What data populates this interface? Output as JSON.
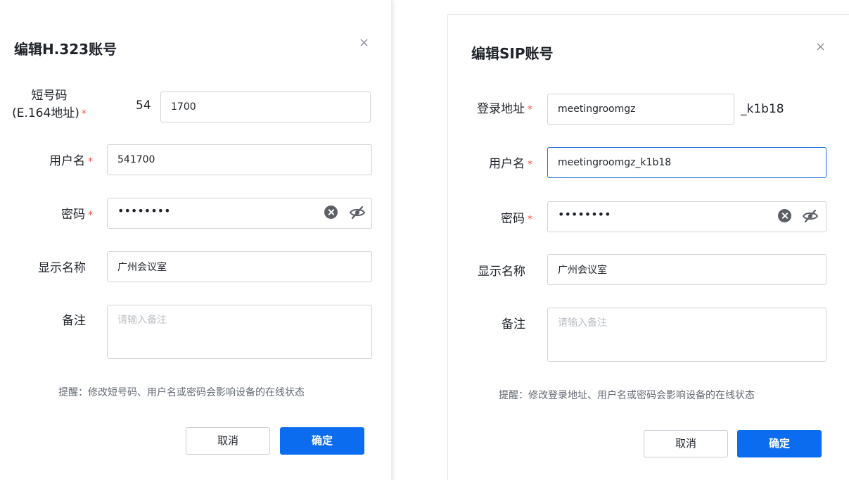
{
  "h323": {
    "title": "编辑H.323账号",
    "close": "×",
    "e164_label_line1": "短号码",
    "e164_label_line2": "(E.164地址)",
    "required_mark": "*",
    "e164_prefix": "54",
    "e164_value": "1700",
    "username_label": "用户名",
    "username_value": "541700",
    "password_label": "密码",
    "password_mask": "••••••••",
    "display_name_label": "显示名称",
    "display_name_value": "广州会议室",
    "note_label": "备注",
    "note_placeholder": "请输入备注",
    "hint": "提醒：修改短号码、用户名或密码会影响设备的在线状态",
    "cancel": "取消",
    "ok": "确定"
  },
  "sip": {
    "title": "编辑SIP账号",
    "close": "×",
    "login_label": "登录地址",
    "required_mark": "*",
    "login_value": "meetingroomgz",
    "login_suffix": "_k1b18",
    "username_label": "用户名",
    "username_value": "meetingroomgz_k1b18",
    "password_label": "密码",
    "password_mask": "••••••••",
    "display_name_label": "显示名称",
    "display_name_value": "广州会议室",
    "note_label": "备注",
    "note_placeholder": "请输入备注",
    "hint": "提醒：修改登录地址、用户名或密码会影响设备的在线状态",
    "cancel": "取消",
    "ok": "确定"
  },
  "icons": {
    "close": "close-icon",
    "clear": "clear-circle-icon",
    "eye": "eye-off-icon"
  },
  "colors": {
    "primary": "#0b6cf0",
    "required": "#f54a45",
    "focus_border": "#1f6fd8"
  }
}
